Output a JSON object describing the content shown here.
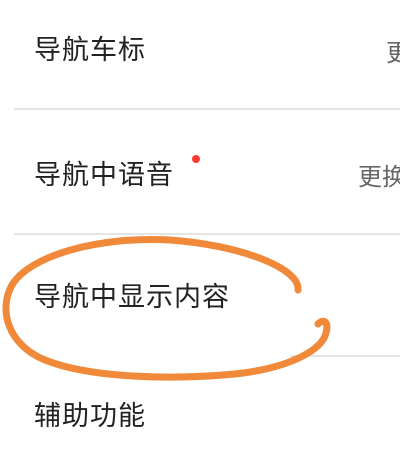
{
  "settings": {
    "items": [
      {
        "label": "导航车标",
        "value": "更"
      },
      {
        "label": "导航中语音",
        "value": "更换",
        "has_badge": true
      },
      {
        "label": "导航中显示内容",
        "value": ""
      },
      {
        "label": "辅助功能",
        "value": ""
      }
    ]
  },
  "colors": {
    "badge": "#ff3b30",
    "annotation": "#f0893a",
    "divider": "#e5e5e5"
  }
}
